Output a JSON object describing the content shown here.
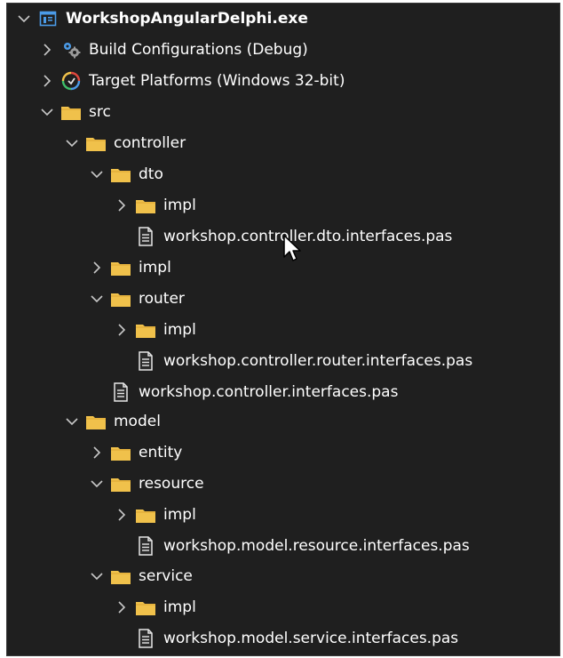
{
  "tree": {
    "project": "WorkshopAngularDelphi.exe",
    "build_configurations": "Build Configurations (Debug)",
    "target_platforms": "Target Platforms (Windows 32-bit)",
    "src": "src",
    "controller": "controller",
    "dto": "dto",
    "dto_impl": "impl",
    "dto_interfaces_file": "workshop.controller.dto.interfaces.pas",
    "controller_impl": "impl",
    "router": "router",
    "router_impl": "impl",
    "router_interfaces_file": "workshop.controller.router.interfaces.pas",
    "controller_interfaces_file": "workshop.controller.interfaces.pas",
    "model": "model",
    "entity": "entity",
    "resource": "resource",
    "resource_impl": "impl",
    "resource_interfaces_file": "workshop.model.resource.interfaces.pas",
    "service": "service",
    "service_impl": "impl",
    "service_interfaces_file": "workshop.model.service.interfaces.pas"
  },
  "colors": {
    "background": "#1f1f1f",
    "text": "#ffffff",
    "folder": "#f0c14b",
    "project_icon": "#4b9be8",
    "chevron": "#c8c8c8"
  }
}
